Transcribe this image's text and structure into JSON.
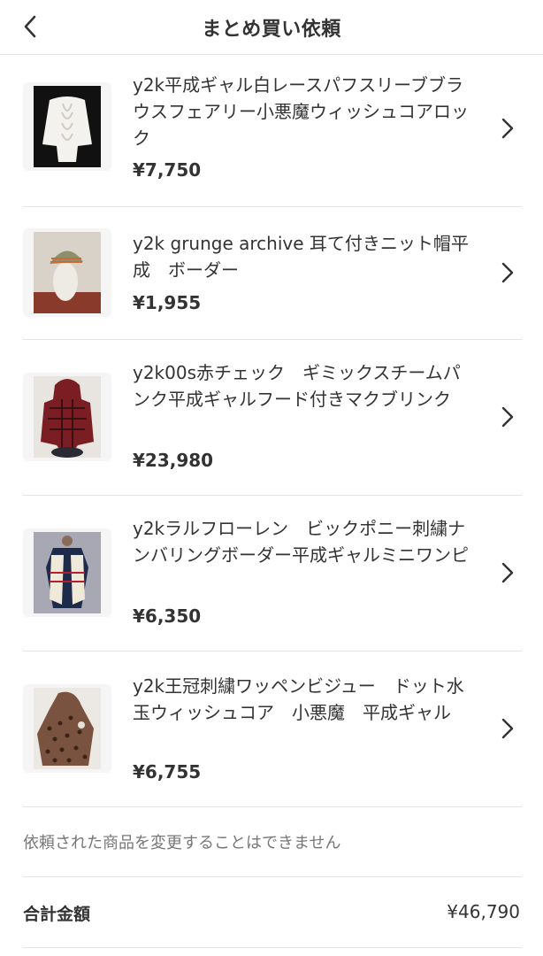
{
  "header": {
    "title": "まとめ買い依頼",
    "back_icon": "chevron-left-icon"
  },
  "items": [
    {
      "name": "y2k平成ギャル白レースパフスリーブブラウスフェアリー小悪魔ウィッシュコアロック",
      "price": "¥7,750"
    },
    {
      "name": "y2k grunge archive 耳て付きニット帽平成　ボーダー",
      "price": "¥1,955"
    },
    {
      "name": "y2k00s赤チェック　ギミックスチームパンク平成ギャルフード付きマクブリンク",
      "price": "¥23,980"
    },
    {
      "name": "y2kラルフローレン　ビックポニー刺繍ナンバリングボーダー平成ギャルミニワンピ",
      "price": "¥6,350"
    },
    {
      "name": "y2k王冠刺繍ワッペンビジュー　ドット水玉ウィッシュコア　小悪魔　平成ギャル",
      "price": "¥6,755"
    }
  ],
  "notice": "依頼された商品を変更することはできません",
  "total": {
    "label": "合計金額",
    "value": "¥46,790"
  }
}
